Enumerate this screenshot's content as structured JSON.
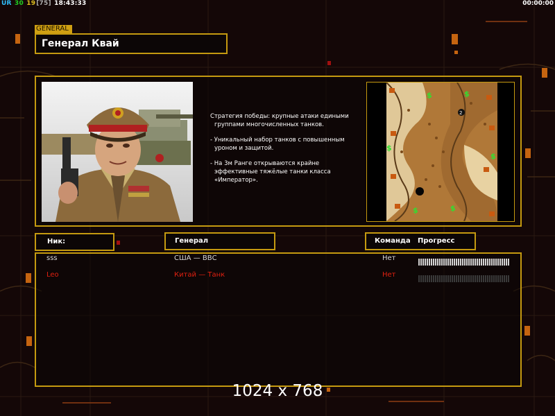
{
  "hud": {
    "ur": "UR",
    "fps": "30",
    "num": "19",
    "bracket": "[75]",
    "clock": "18:43:33",
    "timer": "00:00:00"
  },
  "general": {
    "tag": "GENERAL",
    "name": "Генерал Квай",
    "description": [
      "Стратегия победы: крупные атаки едиными группами многочисленных танков.",
      "- Уникальный набор танков с повышенным уроном и защитой.",
      "- На 3м Ранге открываются крайне эффективные тяжёлые танки класса «Император»."
    ]
  },
  "table": {
    "headers": {
      "nick": "Ник:",
      "general": "Генерал",
      "team": "Команда",
      "progress": "Прогресс"
    },
    "rows": [
      {
        "nick": "sss",
        "general": "США — ВВС",
        "team": "Нет",
        "progress": 1.0,
        "color": "#d8d8d8"
      },
      {
        "nick": "Leo",
        "general": "Китай — Танк",
        "team": "Нет",
        "progress": 0.0,
        "color": "#e02010"
      }
    ]
  },
  "resolution": "1024 x 768",
  "colors": {
    "frame": "#c59a10",
    "accent": "#d0a012",
    "player2": "#e02010"
  }
}
